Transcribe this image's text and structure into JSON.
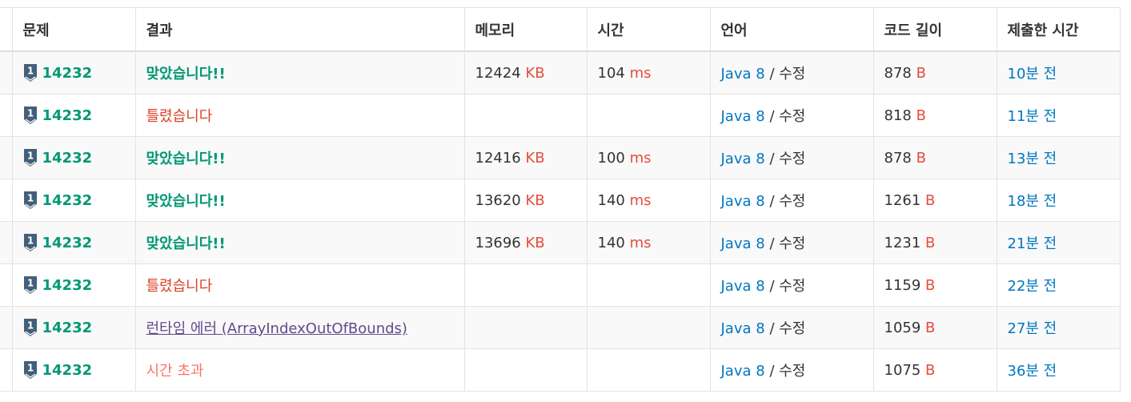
{
  "headers": [
    "문제",
    "결과",
    "메모리",
    "시간",
    "언어",
    "코드 길이",
    "제출한 시간"
  ],
  "units": {
    "memory": "KB",
    "time": "ms",
    "code": "B"
  },
  "lang_sep": "/",
  "rows": [
    {
      "problem": "14232",
      "result": "맞았습니다!!",
      "result_type": "ac",
      "memory": "12424",
      "time": "104",
      "lang": "Java 8",
      "edit": "수정",
      "code_len": "878",
      "submitted": "10분 전"
    },
    {
      "problem": "14232",
      "result": "틀렸습니다",
      "result_type": "wa",
      "memory": "",
      "time": "",
      "lang": "Java 8",
      "edit": "수정",
      "code_len": "818",
      "submitted": "11분 전"
    },
    {
      "problem": "14232",
      "result": "맞았습니다!!",
      "result_type": "ac",
      "memory": "12416",
      "time": "100",
      "lang": "Java 8",
      "edit": "수정",
      "code_len": "878",
      "submitted": "13분 전"
    },
    {
      "problem": "14232",
      "result": "맞았습니다!!",
      "result_type": "ac",
      "memory": "13620",
      "time": "140",
      "lang": "Java 8",
      "edit": "수정",
      "code_len": "1261",
      "submitted": "18분 전"
    },
    {
      "problem": "14232",
      "result": "맞았습니다!!",
      "result_type": "ac",
      "memory": "13696",
      "time": "140",
      "lang": "Java 8",
      "edit": "수정",
      "code_len": "1231",
      "submitted": "21분 전"
    },
    {
      "problem": "14232",
      "result": "틀렸습니다",
      "result_type": "wa",
      "memory": "",
      "time": "",
      "lang": "Java 8",
      "edit": "수정",
      "code_len": "1159",
      "submitted": "22분 전"
    },
    {
      "problem": "14232",
      "result": "런타임 에러 (ArrayIndexOutOfBounds)",
      "result_type": "rte",
      "memory": "",
      "time": "",
      "lang": "Java 8",
      "edit": "수정",
      "code_len": "1059",
      "submitted": "27분 전"
    },
    {
      "problem": "14232",
      "result": "시간 초과",
      "result_type": "tle",
      "memory": "",
      "time": "",
      "lang": "Java 8",
      "edit": "수정",
      "code_len": "1075",
      "submitted": "36분 전"
    }
  ],
  "tier_icon": {
    "name": "silver-1-tier-icon",
    "label": "1",
    "color": "#435f7a"
  },
  "colors": {
    "accepted": "#009874",
    "wrong": "#dd4124",
    "runtime_error": "#5f4b8b",
    "time_limit": "#fa7268",
    "unit": "#e74c3c",
    "link": "#0076c0"
  }
}
